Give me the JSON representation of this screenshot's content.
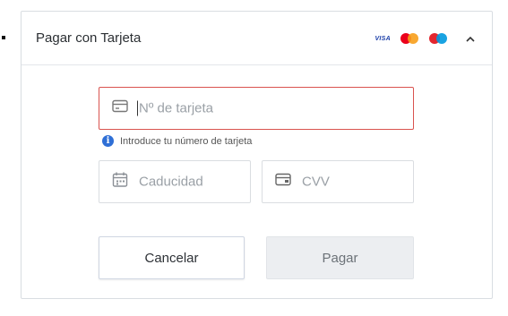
{
  "header": {
    "title": "Pagar con Tarjeta",
    "brands": [
      "visa",
      "mastercard",
      "maestro"
    ],
    "visa_label": "VISA",
    "chevron_icon": "chevron-up-icon"
  },
  "form": {
    "card_number": {
      "placeholder": "Nº de tarjeta",
      "icon": "credit-card-icon",
      "state": "error"
    },
    "hint": {
      "icon": "info-icon",
      "text": "Introduce tu número de tarjeta"
    },
    "expiry": {
      "placeholder": "Caducidad",
      "icon": "calendar-icon"
    },
    "cvv": {
      "placeholder": "CVV",
      "icon": "card-back-icon"
    }
  },
  "actions": {
    "cancel_label": "Cancelar",
    "pay_label": "Pagar"
  },
  "colors": {
    "error": "#d9534f",
    "info": "#2f6fd6",
    "mastercard_red": "#eb001b",
    "mastercard_orange": "#f79e1b",
    "maestro_blue": "#0099df"
  }
}
